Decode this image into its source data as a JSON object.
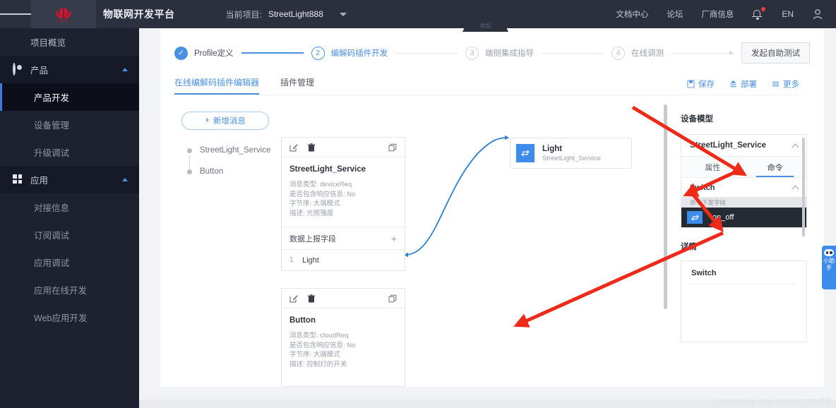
{
  "header": {
    "menu_icon": "hamburger-icon",
    "brand_logo": "huawei-logo",
    "brand_logo_text": "HUAWEI",
    "brand_name": "物联网开发平台",
    "project_label": "当前项目:",
    "project_value": "StreetLight888",
    "links": [
      "文档中心",
      "论坛",
      "厂商信息"
    ],
    "bell_icon": "notification-bell-icon",
    "lang": "EN",
    "user_icon": "user-avatar-icon"
  },
  "sidebar": {
    "items": [
      {
        "label": "项目概览",
        "icon": "home-icon",
        "type": "item"
      },
      {
        "label": "产品",
        "icon": "product-icon",
        "type": "group"
      },
      {
        "label": "产品开发",
        "type": "sub",
        "active": true
      },
      {
        "label": "设备管理",
        "type": "sub",
        "active": false
      },
      {
        "label": "升级调试",
        "type": "sub",
        "active": false
      },
      {
        "label": "应用",
        "icon": "application-icon",
        "type": "group"
      },
      {
        "label": "对接信息",
        "type": "sub",
        "active": false
      },
      {
        "label": "订阅调试",
        "type": "sub",
        "active": false
      },
      {
        "label": "应用调试",
        "type": "sub",
        "active": false
      },
      {
        "label": "应用在线开发",
        "type": "sub",
        "active": false
      },
      {
        "label": "Web应用开发",
        "type": "sub",
        "active": false
      }
    ]
  },
  "collapse_handle": {
    "label": "收起"
  },
  "steps": {
    "items": [
      {
        "num": "✓",
        "label": "Profile定义",
        "state": "done"
      },
      {
        "num": "2",
        "label": "编解码插件开发",
        "state": "cur"
      },
      {
        "num": "3",
        "label": "端侧集成指导",
        "state": "todo"
      },
      {
        "num": "4",
        "label": "在线调测",
        "state": "todo"
      }
    ],
    "action_button": "发起自助测试"
  },
  "tabs": [
    {
      "label": "在线编解码插件编辑器",
      "active": true
    },
    {
      "label": "插件管理",
      "active": false
    }
  ],
  "toolbar": [
    {
      "label": "保存",
      "icon": "save-icon"
    },
    {
      "label": "部署",
      "icon": "deploy-icon"
    },
    {
      "label": "更多",
      "icon": "more-icon"
    }
  ],
  "canvas": {
    "add_message_button": "新增消息",
    "tree": [
      {
        "label": "StreetLight_Service"
      },
      {
        "label": "Button"
      }
    ],
    "cards": [
      {
        "title": "StreetLight_Service",
        "props": [
          "消息类型: deviceReq",
          "是否包含响应信息: No",
          "字节序: 大端模式",
          "描述: 光照强度"
        ],
        "section_title": "数据上报字段",
        "add_symbol": "+",
        "fields": [
          {
            "index": "1",
            "name": "Light"
          }
        ],
        "edit_icon": "edit-icon",
        "delete_icon": "trash-icon",
        "copy_icon": "copy-icon"
      },
      {
        "title": "Button",
        "props": [
          "消息类型: cloudReq",
          "是否包含响应信息: No",
          "字节序: 大端模式",
          "描述: 控制灯的开关"
        ],
        "edit_icon": "edit-icon",
        "delete_icon": "trash-icon",
        "copy_icon": "copy-icon"
      }
    ],
    "node": {
      "icon": "swap-arrow-icon",
      "title": "Light",
      "subtitle": "StreetLight_Service"
    }
  },
  "right_panel": {
    "model_title": "设备模型",
    "service_name": "StreetLight_Service",
    "tabs": [
      {
        "label": "属性",
        "active": false
      },
      {
        "label": "命令",
        "active": true
      }
    ],
    "command_name": "Switch",
    "field_group_title": "命令下发字段",
    "field": {
      "icon": "command-arrow-icon",
      "label": "on_off"
    },
    "detail_title": "详情",
    "detail_item": "Switch"
  },
  "assistant": {
    "icon": "robot-icon",
    "label": "小助手"
  },
  "watermark": "https://blog.csdn.net@51CTO博客",
  "colors": {
    "accent": "#4a90e2",
    "header_bg": "#2b2f3e",
    "sidebar_bg": "#1d2130",
    "annotation_red": "#ee2a19"
  }
}
